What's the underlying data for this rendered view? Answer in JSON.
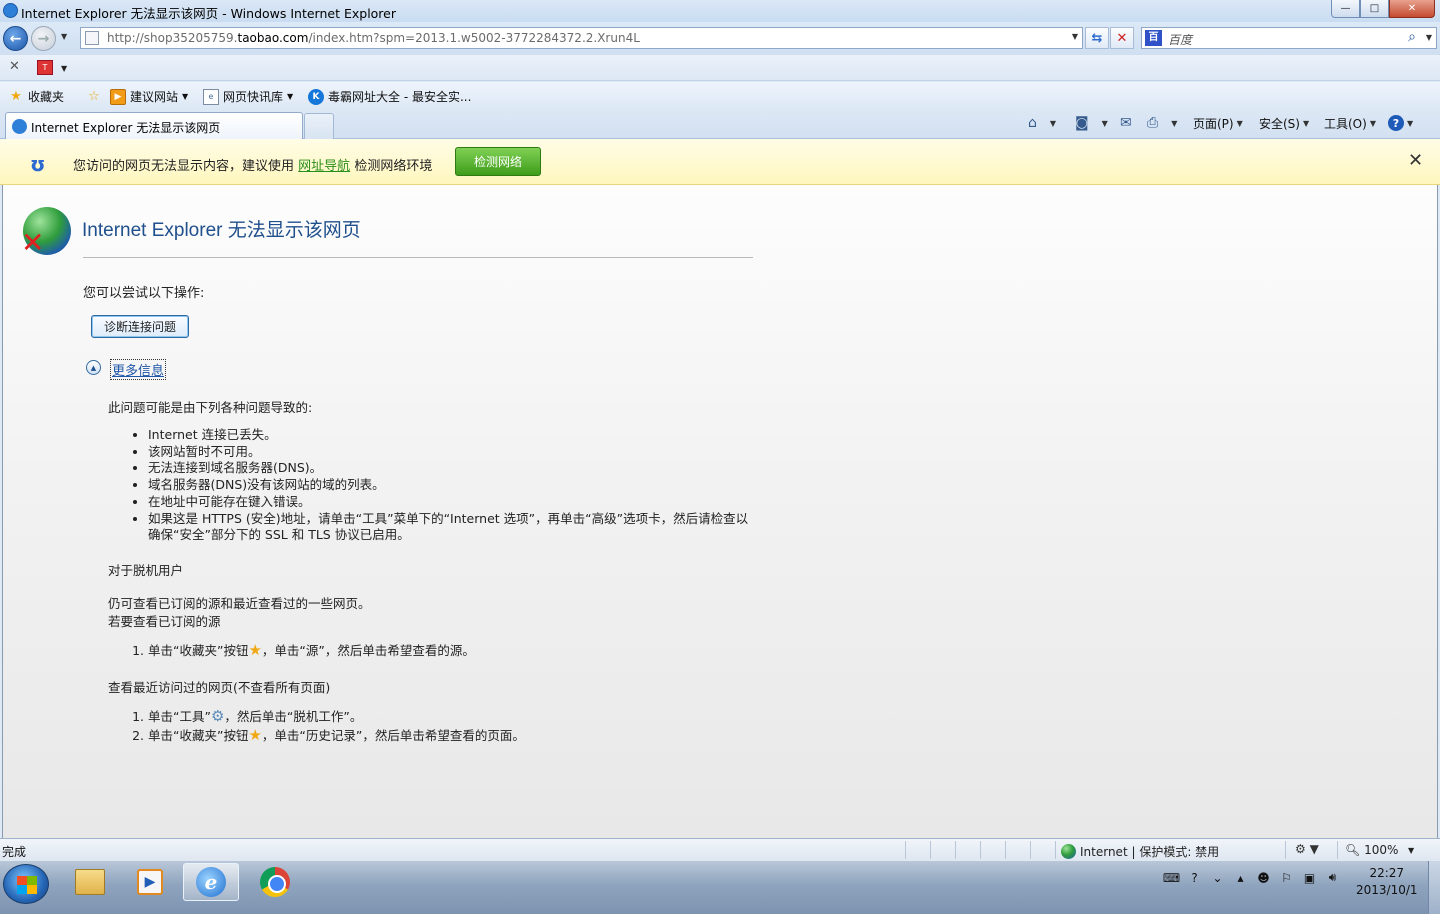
{
  "window": {
    "title": "Internet Explorer 无法显示该网页 - Windows Internet Explorer",
    "buttons": {
      "minimize": "—",
      "maximize": "□",
      "close": "✕"
    }
  },
  "address_bar": {
    "url_prefix": "http://shop35205759.",
    "url_domain": "taobao.com",
    "url_suffix": "/index.htm?spm=2013.1.w5002-3772284372.2.Xrun4L",
    "search_placeholder": "百度"
  },
  "favorites_bar": {
    "items": [
      {
        "label": "收藏夹",
        "icon": "star-icon"
      },
      {
        "label": "",
        "icon": "add-favorite-icon"
      },
      {
        "label": "建议网站",
        "icon": "suggested-sites-icon"
      },
      {
        "label": "网页快讯库",
        "icon": "web-slice-icon"
      },
      {
        "label": "毒霸网址大全 - 最安全实...",
        "icon": "duba-icon"
      }
    ]
  },
  "tab": {
    "label": "Internet Explorer 无法显示该网页"
  },
  "command_bar": {
    "page": "页面(P)",
    "safety": "安全(S)",
    "tools": "工具(O)",
    "help": "?"
  },
  "infobar": {
    "message_prefix": "您访问的网页无法显示内容，建议使用",
    "link": "网址导航",
    "message_suffix": "检测网络环境",
    "button": "检测网络"
  },
  "content": {
    "title": "Internet Explorer 无法显示该网页",
    "try_text": "您可以尝试以下操作:",
    "diagnose_button": "诊断连接问题",
    "more_info": "更多信息",
    "causes_intro": "此问题可能是由下列各种问题导致的:",
    "causes": [
      "Internet 连接已丢失。",
      "该网站暂时不可用。",
      "无法连接到域名服务器(DNS)。",
      "域名服务器(DNS)没有该网站的域的列表。",
      "在地址中可能存在键入错误。",
      "如果这是 HTTPS (安全)地址，请单击“工具”菜单下的“Internet 选项”，再单击“高级”选项卡，然后请检查以确保“安全”部分下的 SSL 和 TLS 协议已启用。"
    ],
    "offline_heading": "对于脱机用户",
    "offline_line1": "仍可查看已订阅的源和最近查看过的一些网页。",
    "offline_line2": "若要查看已订阅的源",
    "feed_step1_a": "单击“收藏夹”按钮",
    "feed_step1_b": "，单击“源”，然后单击希望查看的源。",
    "recent_heading": "查看最近访问过的网页(不查看所有页面)",
    "recent_step1_a": "单击“工具”",
    "recent_step1_b": "，然后单击“脱机工作”。",
    "recent_step2_a": "单击“收藏夹”按钮",
    "recent_step2_b": "，单击“历史记录”，然后单击希望查看的页面。"
  },
  "status_bar": {
    "status": "完成",
    "zone": "Internet | 保护模式: 禁用",
    "zoom": "100%"
  },
  "taskbar": {
    "clock_time": "22:27",
    "clock_date": "2013/10/1"
  }
}
